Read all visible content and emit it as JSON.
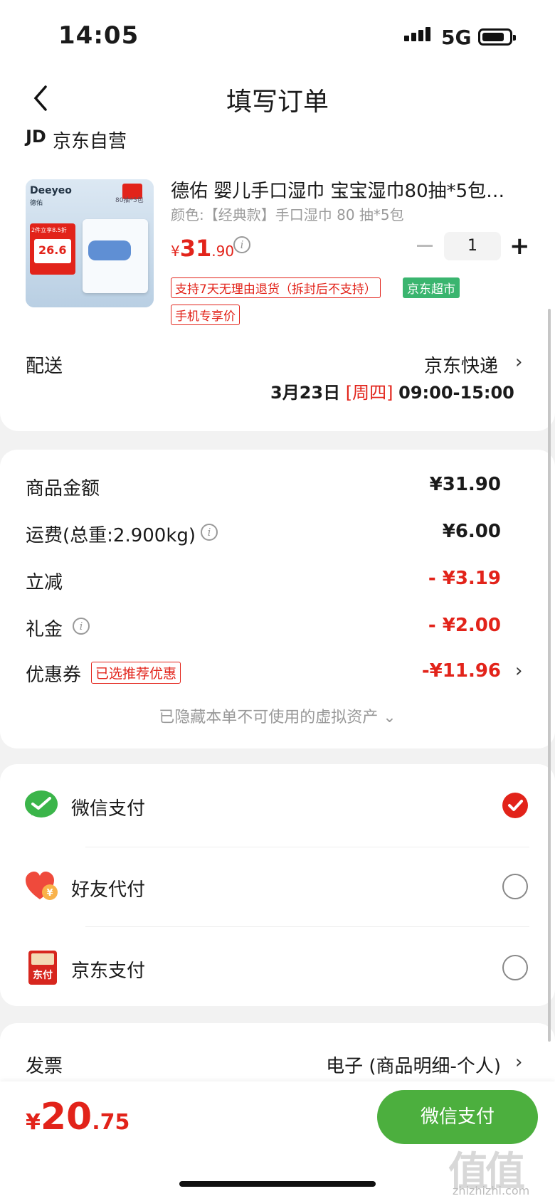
{
  "status": {
    "time": "14:05",
    "network": "5G"
  },
  "header": {
    "title": "填写订单"
  },
  "shop": {
    "logo": "JD",
    "name": "京东自营"
  },
  "product": {
    "title": "德佑 婴儿手口湿巾 宝宝湿巾80抽*5包…",
    "spec": "颜色:【经典款】手口湿巾 80 抽*5包",
    "price_symbol": "¥",
    "price_int": "31",
    "price_dec": ".90",
    "quantity": "1",
    "tags": [
      "支持7天无理由退货（拆封后不支持）",
      "京东超市",
      "手机专享价"
    ],
    "thumb": {
      "brand": "Deeyeo",
      "brand_sub": "德佑",
      "promo": "2件立享8.5折",
      "price": "26.6",
      "pack": "80抽*5包"
    }
  },
  "delivery": {
    "label": "配送",
    "carrier": "京东快递",
    "date": "3月23日",
    "weekday": "[周四]",
    "window": "09:00-15:00"
  },
  "costs": {
    "goods_label": "商品金额",
    "goods_value": "¥31.90",
    "shipping_label": "运费(总重:2.900kg)",
    "shipping_value": "¥6.00",
    "discount_label": "立减",
    "discount_value": "- ¥3.19",
    "gift_label": "礼金",
    "gift_value": "- ¥2.00",
    "coupon_label": "优惠券",
    "coupon_tag": "已选推荐优惠",
    "coupon_value": "-¥11.96",
    "hidden_note": "已隐藏本单不可使用的虚拟资产 ⌄"
  },
  "payment": {
    "methods": [
      {
        "label": "微信支付",
        "selected": true
      },
      {
        "label": "好友代付",
        "selected": false
      },
      {
        "label": "京东支付",
        "selected": false
      }
    ],
    "jd_icon_text": "东付"
  },
  "invoice": {
    "label": "发票",
    "value": "电子 (商品明细-个人)"
  },
  "footer": {
    "total_symbol": "¥",
    "total_int": "20",
    "total_dec": ".75",
    "pay_button": "微信支付"
  },
  "watermark": {
    "text": "值值值",
    "url": "zhizhizhi.com"
  },
  "colors": {
    "accent": "#e2231a",
    "wechat": "#4caf3e",
    "jd_green": "#3ab56f"
  },
  "icons": [
    "back-icon",
    "info-icon",
    "chevron-right-icon",
    "wechat-icon",
    "friend-pay-icon",
    "jd-pay-icon",
    "check-icon"
  ]
}
